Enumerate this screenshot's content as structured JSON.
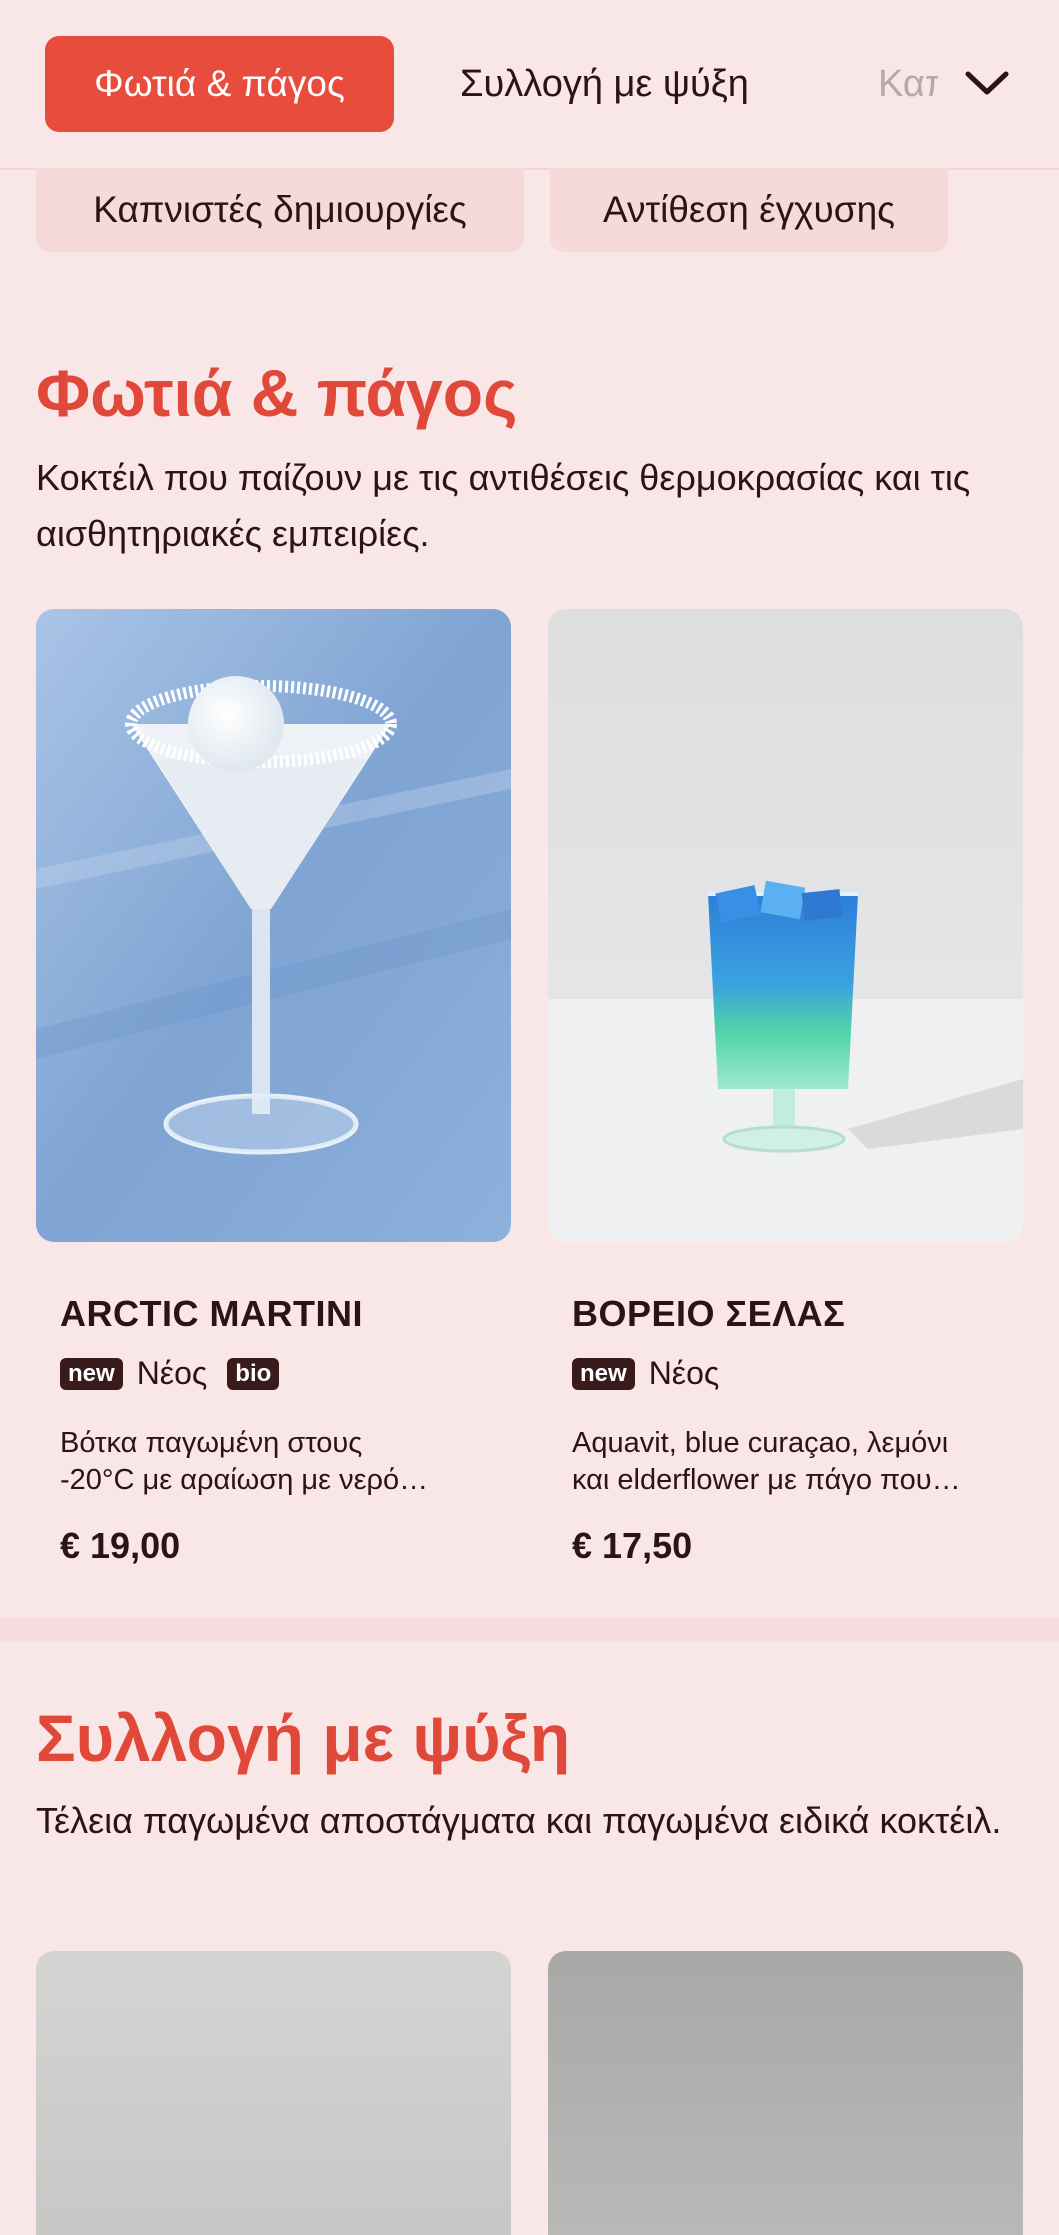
{
  "nav": {
    "tabs": [
      {
        "label": "Φωτιά & πάγος",
        "active": true
      },
      {
        "label": "Συλλογή με ψύξη",
        "active": false
      },
      {
        "label": "Καπνιστές δημιουργίες",
        "active": false
      }
    ],
    "expand_icon": "chevron-down-icon"
  },
  "subnav": {
    "chips": [
      "Καπνιστές δημιουργίες",
      "Αντίθεση έγχυσης"
    ]
  },
  "sections": [
    {
      "title": "Φωτιά & πάγος",
      "description": "Κοκτέιλ που παίζουν με τις αντιθέσεις θερμοκρασίας και τις αισθητηριακές εμπειρίες.",
      "items": [
        {
          "name": "ARCTIC MARTINI",
          "badges": [
            "new"
          ],
          "badge_label": "Νέος",
          "extra_badge": "bio",
          "description_line1": "Βότκα παγωμένη στους",
          "description_line2": "-20°C με αραίωση με νερό…",
          "price": "€ 19,00"
        },
        {
          "name": "ΒΟΡΕΙΟ ΣΕΛΑΣ",
          "badges": [
            "new"
          ],
          "badge_label": "Νέος",
          "description_line1": "Aquavit, blue curaçao, λεμόνι",
          "description_line2": "και elderflower με πάγο που…",
          "price": "€ 17,50"
        }
      ]
    },
    {
      "title": "Συλλογή με ψύξη",
      "description": "Τέλεια παγωμένα αποστάγματα και παγωμένα ειδικά κοκτέιλ."
    }
  ],
  "colors": {
    "accent": "#e74c3c",
    "background": "#f9e6e6",
    "badge": "#3a1b1b"
  }
}
